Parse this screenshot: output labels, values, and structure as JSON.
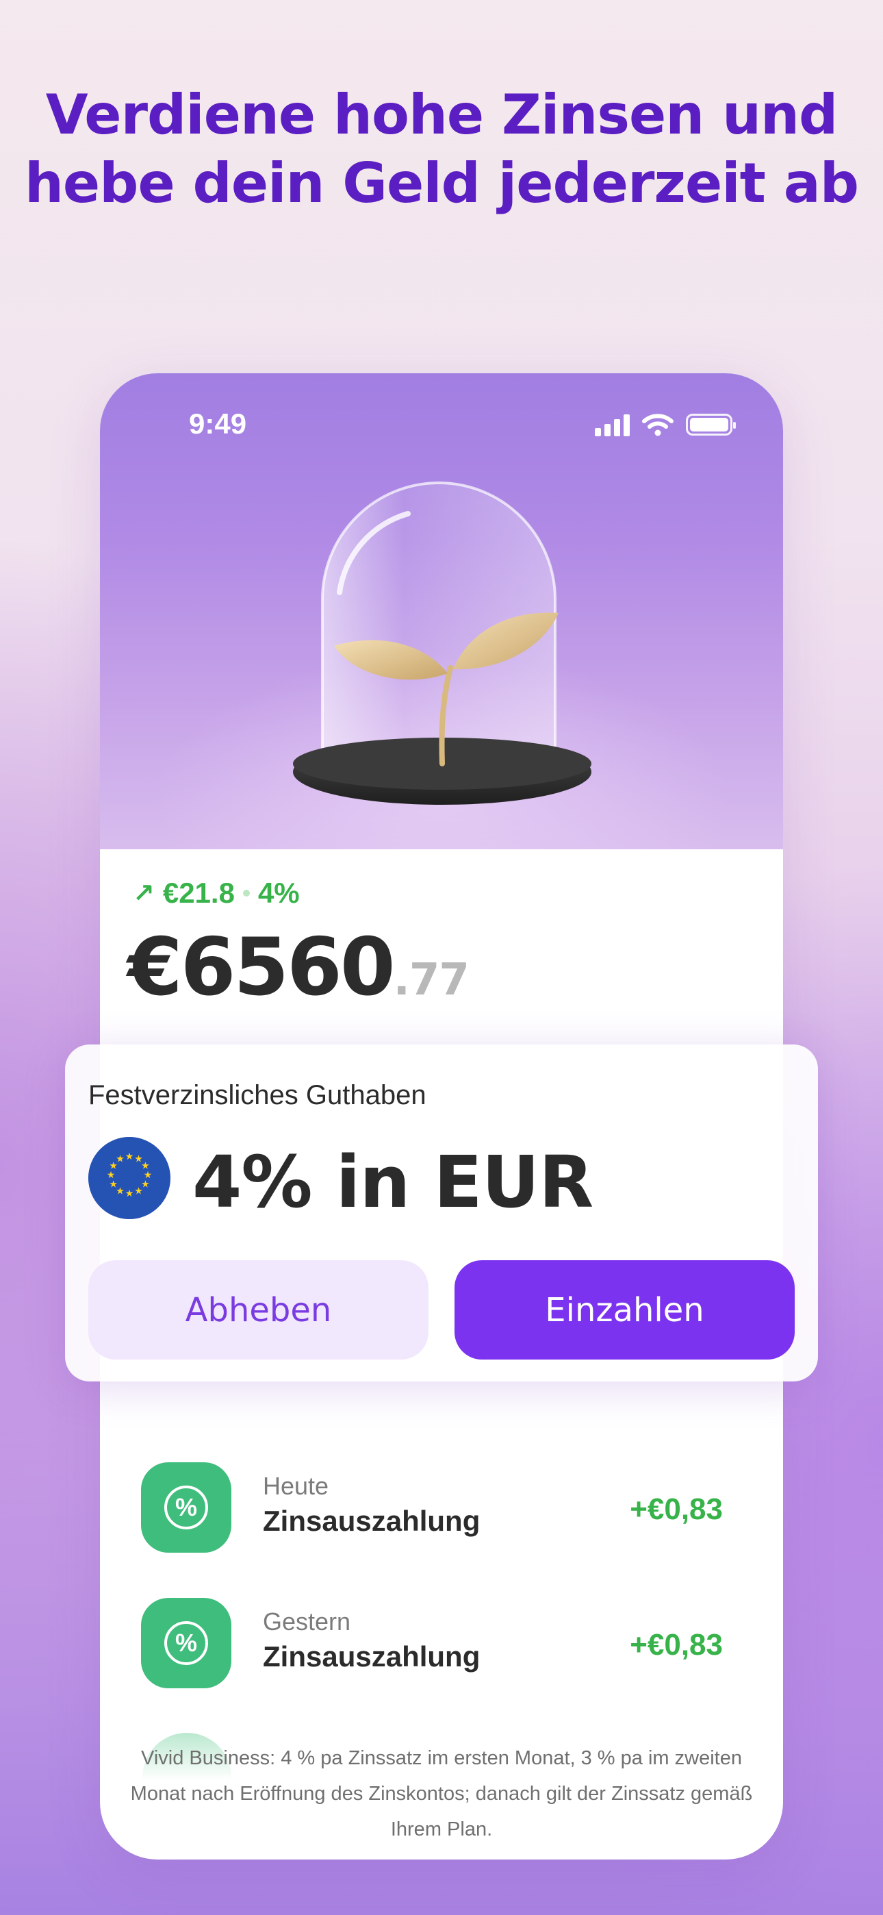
{
  "headline": {
    "line1": "Verdiene hohe Zinsen und",
    "line2": "hebe dein Geld jederzeit ab"
  },
  "status_bar": {
    "time": "9:49",
    "icons": [
      "signal-icon",
      "wifi-icon",
      "battery-icon"
    ]
  },
  "balance": {
    "change_amount": "€21.8",
    "change_rate": "4%",
    "main": "€6560",
    "cents": ".77"
  },
  "savings_card": {
    "label": "Festverzinsliches Guthaben",
    "rate_text": "4% in EUR",
    "flag_icon": "eu-flag-icon",
    "withdraw_label": "Abheben",
    "deposit_label": "Einzahlen"
  },
  "transactions": [
    {
      "day": "Heute",
      "title": "Zinsauszahlung",
      "amount": "+€0,83",
      "icon": "percent-icon"
    },
    {
      "day": "Gestern",
      "title": "Zinsauszahlung",
      "amount": "+€0,83",
      "icon": "percent-icon"
    }
  ],
  "disclaimer": "Vivid Business: 4 % pa Zinssatz im ersten Monat, 3 % pa im zweiten Monat nach Eröffnung des Zinskontos; danach gilt der Zinssatz gemäß Ihrem Plan.",
  "colors": {
    "headline": "#5b1ec2",
    "accent_purple": "#7c33ef",
    "positive_green": "#37b34a",
    "icon_green": "#3fbd7c"
  }
}
